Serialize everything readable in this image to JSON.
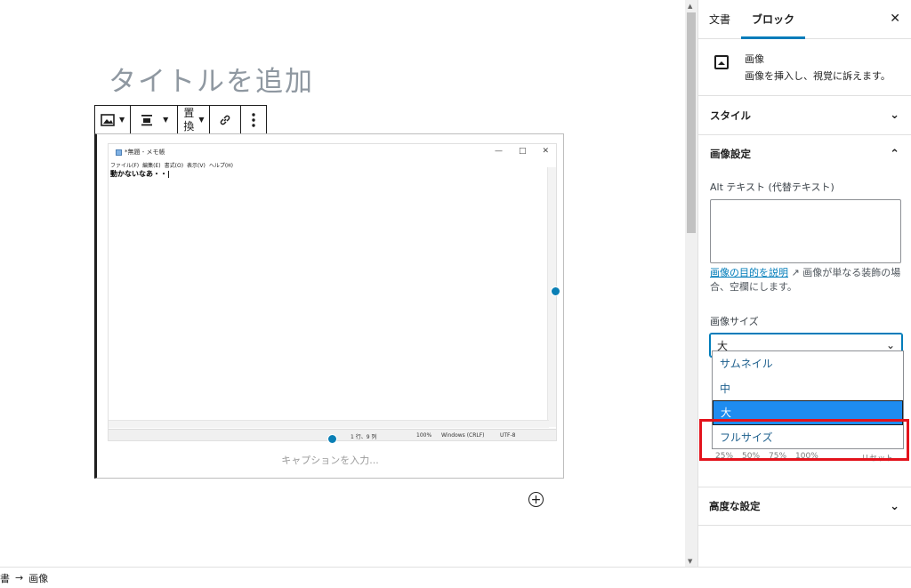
{
  "editor": {
    "title_placeholder": "タイトルを追加",
    "toolbar": {
      "image_icon": "image-icon",
      "align_icon": "align-icon",
      "replace_label_top": "置",
      "replace_label_bottom": "換",
      "link_icon": "link-icon",
      "more_icon": "more-options-icon"
    },
    "image": {
      "notepad_title": "*無題 - メモ帳",
      "notepad_win_buttons": [
        "—",
        "□",
        "✕"
      ],
      "notepad_menu": [
        "ファイル(F)",
        "編集(E)",
        "書式(O)",
        "表示(V)",
        "ヘルプ(H)"
      ],
      "notepad_text": "動かないなあ・・|",
      "status_position": "1 行、9 列",
      "status_zoom": "100%",
      "status_eol": "Windows (CRLF)",
      "status_encoding": "UTF-8"
    },
    "caption_placeholder": "キャプションを入力..."
  },
  "sidebar": {
    "tabs": [
      "文書",
      "ブロック"
    ],
    "active_tab": "ブロック",
    "close": "✕",
    "block": {
      "name": "画像",
      "description": "画像を挿入し、視覚に訴えます。"
    },
    "style_panel": "スタイル",
    "image_settings": {
      "heading": "画像設定",
      "alt_label": "Alt テキスト (代替テキスト)",
      "alt_value": "",
      "help_link": "画像の目的を説明",
      "help_text": "画像が単なる装飾の場合、空欄にします。",
      "size_label": "画像サイズ",
      "size_value": "大",
      "size_options": [
        "サムネイル",
        "中",
        "大",
        "フルサイズ"
      ],
      "selected_option": "大",
      "scale_options": [
        "25%",
        "50%",
        "75%",
        "100%"
      ],
      "reset_label": "リセット"
    },
    "advanced_panel": "高度な設定"
  },
  "footer": {
    "breadcrumb": [
      "書",
      "→",
      "画像"
    ]
  },
  "colors": {
    "accent": "#007cba",
    "highlight": "#e3121b",
    "selected_option_bg": "#1e8cf0"
  }
}
